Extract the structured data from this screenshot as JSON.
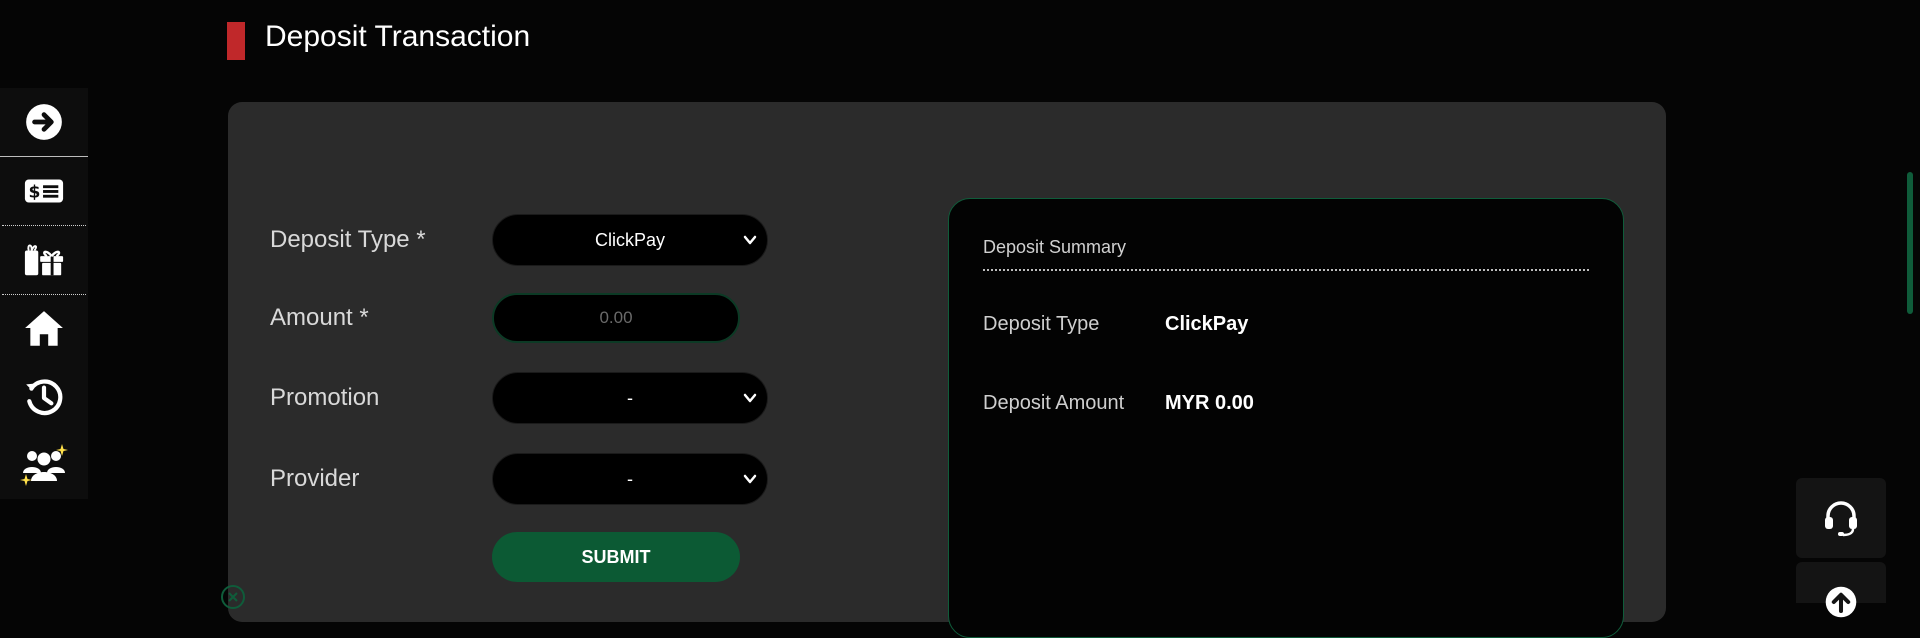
{
  "page": {
    "title": "Deposit Transaction"
  },
  "sidebar": {
    "items": [
      {
        "icon": "arrow-right-circle-icon"
      },
      {
        "icon": "cash-icon"
      },
      {
        "icon": "gift-icon"
      },
      {
        "icon": "home-icon"
      },
      {
        "icon": "history-icon"
      },
      {
        "icon": "referral-users-icon"
      }
    ]
  },
  "form": {
    "deposit_type_label": "Deposit Type *",
    "deposit_type_value": "ClickPay",
    "amount_label": "Amount *",
    "amount_placeholder": "0.00",
    "promotion_label": "Promotion",
    "promotion_value": "-",
    "provider_label": "Provider",
    "provider_value": "-",
    "submit_label": "SUBMIT"
  },
  "summary": {
    "title": "Deposit Summary",
    "deposit_type_label": "Deposit Type",
    "deposit_type_value": "ClickPay",
    "deposit_amount_label": "Deposit Amount",
    "deposit_amount_value": "MYR 0.00"
  },
  "floating": {
    "support_icon": "headset-icon",
    "scroll_top_icon": "arrow-up-circle-icon"
  },
  "colors": {
    "accent_red": "#c0282a",
    "accent_green": "#0c5a34",
    "panel_bg": "#2b2b2b",
    "page_bg": "#050505"
  }
}
